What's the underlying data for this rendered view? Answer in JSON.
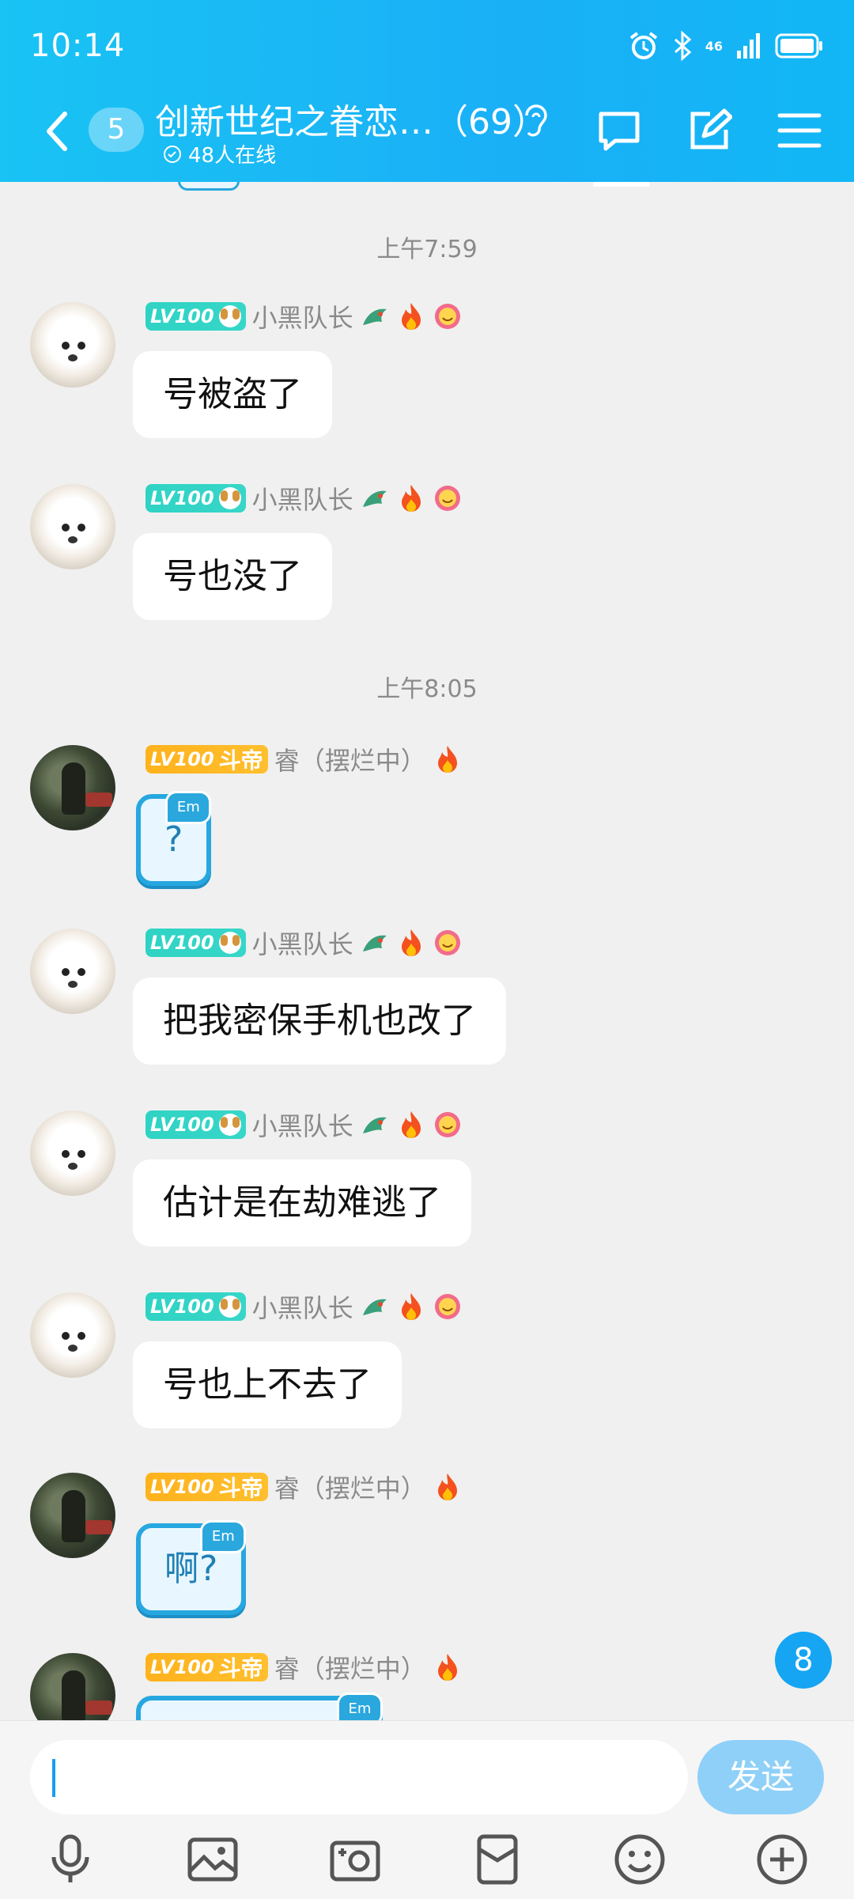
{
  "status_bar": {
    "time": "10:14",
    "network": "46"
  },
  "header": {
    "unread_count": "5",
    "group_name": "创新世纪之眷恋…（69）",
    "online": "48人在线"
  },
  "messages_area": {
    "timestamps": [
      "上午7:59",
      "上午8:05"
    ],
    "messages": [
      {
        "level": "LV100",
        "rank": "",
        "sender": "小黑队长",
        "text": "号被盗了",
        "type": "text"
      },
      {
        "level": "LV100",
        "rank": "",
        "sender": "小黑队长",
        "text": "号也没了",
        "type": "text"
      },
      {
        "level": "LV100",
        "rank": "斗帝",
        "sender": "睿（摆烂中）",
        "text": "?",
        "type": "emoticon",
        "tag": "Em"
      },
      {
        "level": "LV100",
        "rank": "",
        "sender": "小黑队长",
        "text": "把我密保手机也改了",
        "type": "text"
      },
      {
        "level": "LV100",
        "rank": "",
        "sender": "小黑队长",
        "text": "估计是在劫难逃了",
        "type": "text"
      },
      {
        "level": "LV100",
        "rank": "",
        "sender": "小黑队长",
        "text": "号也上不去了",
        "type": "text"
      },
      {
        "level": "LV100",
        "rank": "斗帝",
        "sender": "睿（摆烂中）",
        "text": "啊?",
        "type": "emoticon",
        "tag": "Em"
      },
      {
        "level": "LV100",
        "rank": "斗帝",
        "sender": "睿（摆烂中）",
        "text": "",
        "type": "emoticon",
        "tag": "Em"
      }
    ],
    "new_message_count": "8"
  },
  "composer": {
    "input_value": "",
    "send_label": "发送"
  },
  "toolbar": {
    "icons": [
      "microphone-icon",
      "image-icon",
      "camera-icon",
      "red-packet-icon",
      "emoji-icon",
      "plus-icon"
    ]
  },
  "colors": {
    "header": "#12b7f5",
    "accent": "#15a5f2",
    "send_disabled": "#8fd0f8",
    "teal_badge": "#2fd3c4",
    "gold_badge": "#ffb21c"
  }
}
